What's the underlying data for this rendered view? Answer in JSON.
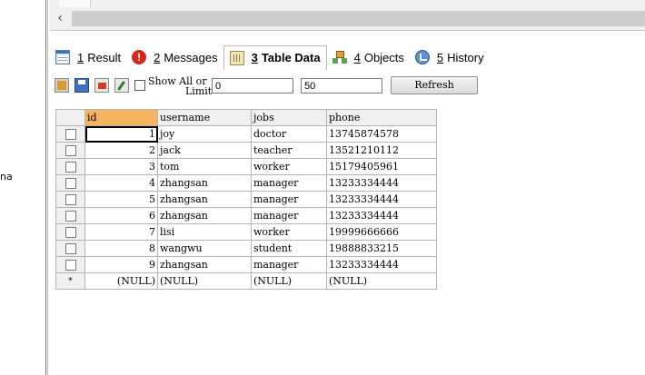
{
  "left_panel": {
    "cut_text": "na"
  },
  "tabs": [
    {
      "num": "1",
      "label": "Result",
      "icon": "result-grid-icon",
      "active": false
    },
    {
      "num": "2",
      "label": "Messages",
      "icon": "messages-icon",
      "active": false
    },
    {
      "num": "3",
      "label": "Table Data",
      "icon": "table-data-icon",
      "active": true
    },
    {
      "num": "4",
      "label": "Objects",
      "icon": "objects-icon",
      "active": false
    },
    {
      "num": "5",
      "label": "History",
      "icon": "history-icon",
      "active": false
    }
  ],
  "toolbar": {
    "show_all_line1": "Show All or",
    "show_all_line2": "Limit",
    "limit_start": "0",
    "limit_count": "50",
    "refresh_label": "Refresh"
  },
  "grid": {
    "columns": [
      "id",
      "username",
      "jobs",
      "phone"
    ],
    "sorted_column": "id",
    "rows": [
      {
        "id": "1",
        "username": "joy",
        "jobs": "doctor",
        "phone": "13745874578"
      },
      {
        "id": "2",
        "username": "jack",
        "jobs": "teacher",
        "phone": "13521210112"
      },
      {
        "id": "3",
        "username": "tom",
        "jobs": "worker",
        "phone": "15179405961"
      },
      {
        "id": "4",
        "username": "zhangsan",
        "jobs": "manager",
        "phone": "13233334444"
      },
      {
        "id": "5",
        "username": "zhangsan",
        "jobs": "manager",
        "phone": "13233334444"
      },
      {
        "id": "6",
        "username": "zhangsan",
        "jobs": "manager",
        "phone": "13233334444"
      },
      {
        "id": "7",
        "username": "lisi",
        "jobs": "worker",
        "phone": "19999666666"
      },
      {
        "id": "8",
        "username": "wangwu",
        "jobs": "student",
        "phone": "19888833215"
      },
      {
        "id": "9",
        "username": "zhangsan",
        "jobs": "manager",
        "phone": "13233334444"
      }
    ],
    "new_row_marker": "*",
    "null_text": "(NULL)"
  }
}
